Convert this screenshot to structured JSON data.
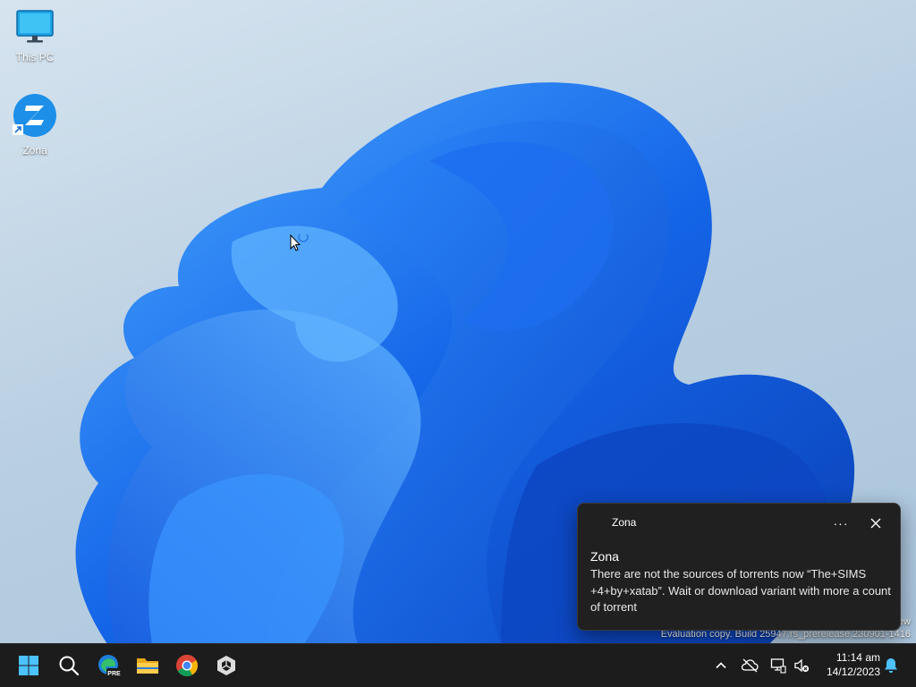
{
  "desktop": {
    "icons": [
      {
        "label": "This PC",
        "icon": "monitor-icon"
      },
      {
        "label": "Zona",
        "icon": "zona-app-icon"
      }
    ],
    "watermark": {
      "line1": "ew",
      "line2": "Evaluation copy. Build 25947.rs_prerelease.230901-1416"
    }
  },
  "taskbar": {
    "apps": [
      {
        "name": "Start",
        "icon": "windows-logo-icon"
      },
      {
        "name": "Search",
        "icon": "search-icon"
      },
      {
        "name": "Microsoft Edge Preview",
        "icon": "edge-icon",
        "badge": "PRE"
      },
      {
        "name": "File Explorer",
        "icon": "folder-icon"
      },
      {
        "name": "Google Chrome",
        "icon": "chrome-icon"
      },
      {
        "name": "Unity",
        "icon": "unity-icon"
      }
    ],
    "tray": {
      "icons": [
        "chevron-up-icon",
        "cloud-off-icon",
        "network-icon",
        "volume-muted-icon"
      ],
      "time": "11:14 am",
      "date": "14/12/2023",
      "notification_icon": "bell-icon"
    }
  },
  "notification": {
    "app_name": "Zona",
    "more_label": "···",
    "title": "Zona",
    "message": "There are not the sources of torrents now “The+SIMS +4+by+xatab”. Wait or download variant with more a count of torrent"
  },
  "colors": {
    "accent": "#0078d4",
    "taskbar_bg": "#1c1c1c",
    "toast_bg": "#202020",
    "bloom_dark": "#0a3fb5",
    "bloom_light": "#4aa3ff"
  }
}
